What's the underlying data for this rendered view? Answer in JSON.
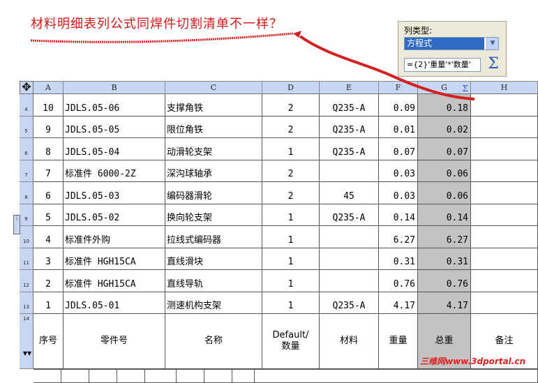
{
  "annotation": {
    "text": "材料明细表列公式同焊件切割清单不一样？",
    "color": "#d01818"
  },
  "column_panel": {
    "label": "列类型:",
    "selected_type": "方程式",
    "formula": "={2}'重量'*'数量'",
    "sum_icon": "sigma-icon"
  },
  "table": {
    "columns": [
      "A",
      "B",
      "C",
      "D",
      "E",
      "F",
      "G",
      "H"
    ],
    "rows": [
      {
        "num": "4",
        "cells": [
          "10",
          "JDLS.05-06",
          "支撑角铁",
          "2",
          "Q235-A",
          "0.09",
          "0.18",
          ""
        ]
      },
      {
        "num": "5",
        "cells": [
          "9",
          "JDLS.05-05",
          "限位角铁",
          "2",
          "Q235-A",
          "0.01",
          "0.02",
          ""
        ]
      },
      {
        "num": "6",
        "cells": [
          "8",
          "JDLS.05-04",
          "动滑轮支架",
          "1",
          "Q235-A",
          "0.07",
          "0.07",
          ""
        ]
      },
      {
        "num": "7",
        "cells": [
          "7",
          "标准件 6000-2Z",
          "深沟球轴承",
          "2",
          "",
          "0.03",
          "0.06",
          ""
        ]
      },
      {
        "num": "8",
        "cells": [
          "6",
          "JDLS.05-03",
          "编码器滑轮",
          "2",
          "45",
          "0.03",
          "0.06",
          ""
        ]
      },
      {
        "num": "9",
        "cells": [
          "5",
          "JDLS.05-02",
          "换向轮支架",
          "1",
          "Q235-A",
          "0.14",
          "0.14",
          ""
        ]
      },
      {
        "num": "10",
        "cells": [
          "4",
          "标准件外购",
          "拉线式编码器",
          "1",
          "",
          "6.27",
          "6.27",
          ""
        ]
      },
      {
        "num": "11",
        "cells": [
          "3",
          "标准件 HGH15CA",
          "直线滑块",
          "1",
          "",
          "0.31",
          "0.31",
          ""
        ]
      },
      {
        "num": "12",
        "cells": [
          "2",
          "标准件 HGH15CA",
          "直线导轨",
          "1",
          "",
          "0.76",
          "0.76",
          ""
        ]
      },
      {
        "num": "13",
        "cells": [
          "1",
          "JDLS.05-01",
          "测速机构支架",
          "1",
          "Q235-A",
          "4.17",
          "4.17",
          ""
        ]
      }
    ],
    "footer_row_num": "14",
    "footer": {
      "c0": "序号",
      "c1": "零件号",
      "c2": "名称",
      "c3_line1": "Default/",
      "c3_line2": "数量",
      "c4": "材料",
      "c5": "重量",
      "c6": "总重",
      "c7": "备注"
    },
    "shaded_column_color": "#c3c3c3",
    "header_color": "#c6d6f3"
  },
  "watermark": "三维网www.3dportal.cn"
}
